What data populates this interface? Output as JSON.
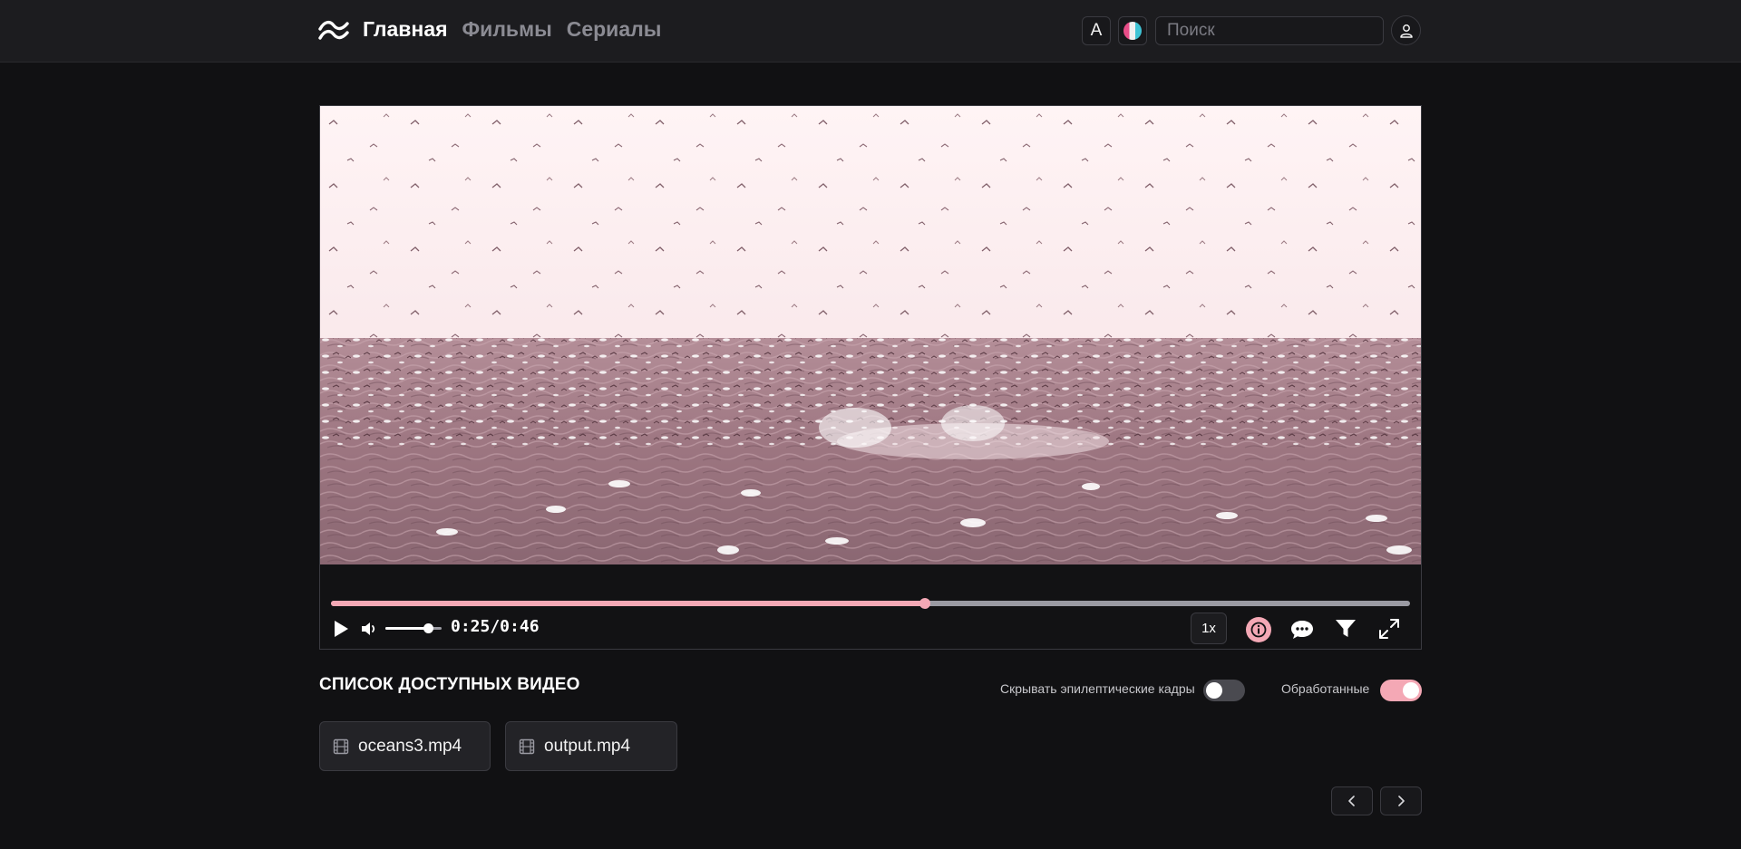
{
  "header": {
    "logo_icon": "tailwind-wave-icon",
    "nav": [
      {
        "label": "Главная",
        "active": true
      },
      {
        "label": "Фильмы",
        "active": false
      },
      {
        "label": "Сериалы",
        "active": false
      }
    ],
    "font_button_label": "A",
    "palette_icon": "color-palette-icon",
    "search": {
      "placeholder": "Поиск",
      "value": ""
    },
    "user_icon": "user-icon"
  },
  "player": {
    "progress": 0.55,
    "volume": 0.75,
    "time_label": "0:25/0:46",
    "speed_label": "1x",
    "icons": [
      "play-icon",
      "volume-icon",
      "info-icon",
      "subtitles-icon",
      "filter-icon",
      "fullscreen-icon"
    ],
    "accent_color": "#f4a8b5"
  },
  "video_list": {
    "title": "СПИСОК ДОСТУПНЫХ ВИДЕО",
    "toggles": [
      {
        "label": "Скрывать эпилептические кадры",
        "on": false
      },
      {
        "label": "Обработанные",
        "on": true
      }
    ],
    "files": [
      {
        "name": "oceans3.mp4",
        "icon": "film-icon"
      },
      {
        "name": "output.mp4",
        "icon": "film-icon"
      }
    ],
    "pager_icons": [
      "chevron-left-icon",
      "chevron-right-icon"
    ]
  }
}
